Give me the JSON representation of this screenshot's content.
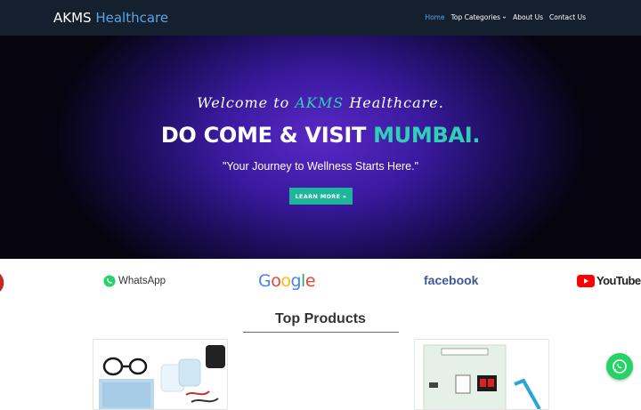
{
  "header": {
    "brand_main": "AKMS",
    "brand_accent": "Healthcare",
    "nav": [
      "Home",
      "Top Categories",
      "About Us",
      "Contact Us"
    ]
  },
  "hero": {
    "welcome_prefix": "Welcome to",
    "welcome_brand": "AKMS",
    "welcome_suffix": "Healthcare.",
    "headline_main": "DO COME & VISIT",
    "headline_accent": "MUMBAI.",
    "tagline": "\"Your Journey to Wellness Starts Here.\"",
    "cta_label": "LEARN MORE »"
  },
  "partners": {
    "whatsapp": "WhatsApp",
    "google": [
      "G",
      "o",
      "o",
      "g",
      "l",
      "e"
    ],
    "facebook": "facebook",
    "youtube": "YouTube"
  },
  "products": {
    "title": "Top Products"
  },
  "colors": {
    "nav_bg": "#14202e",
    "accent_blue": "#5aa4e6",
    "accent_teal": "#2fd0b5",
    "cta": "#1fb59a",
    "whatsapp": "#25d366"
  },
  "icons": [
    "chevron-down-icon",
    "whatsapp-icon",
    "youtube-icon",
    "whatsapp-float-icon"
  ]
}
